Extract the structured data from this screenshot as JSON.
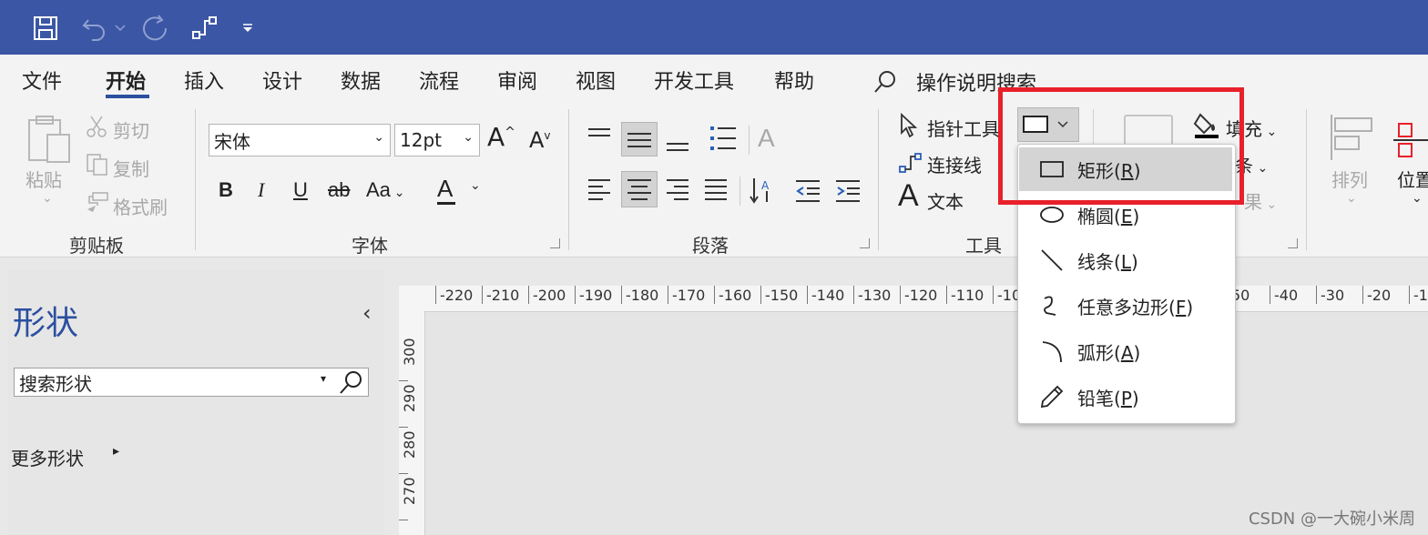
{
  "menu": {
    "items": [
      "文件",
      "开始",
      "插入",
      "设计",
      "数据",
      "流程",
      "审阅",
      "视图",
      "开发工具",
      "帮助"
    ],
    "active": "开始",
    "search_label": "操作说明搜索"
  },
  "clipboard": {
    "paste": "粘贴",
    "cut": "剪切",
    "copy": "复制",
    "format_painter": "格式刷",
    "group_label": "剪贴板"
  },
  "font": {
    "name": "宋体",
    "size": "12pt",
    "bold": "B",
    "italic": "I",
    "underline": "U",
    "strike": "ab",
    "case": "Aa",
    "color": "A",
    "grow": "A",
    "shrink": "A",
    "group_label": "字体"
  },
  "paragraph": {
    "group_label": "段落"
  },
  "tools": {
    "pointer": "指针工具",
    "connector": "连接线",
    "text": "文本",
    "text_icon": "A",
    "group_label": "工具"
  },
  "shape_style": {
    "fill": "填充",
    "line": "条",
    "effects": "果"
  },
  "arrange": {
    "arrange_label": "排列",
    "position_label": "位置"
  },
  "shapes_panel": {
    "title": "形状",
    "search_placeholder": "搜索形状",
    "more_shapes": "更多形状"
  },
  "ruler": {
    "horizontal": [
      "-220",
      "-210",
      "-200",
      "-190",
      "-180",
      "-170",
      "-160",
      "-150",
      "-140",
      "-130",
      "-120",
      "-110",
      "-10",
      "50",
      "-40",
      "-30",
      "-20",
      "-1"
    ],
    "vertical": [
      "300",
      "290",
      "280",
      "270"
    ]
  },
  "dropdown": {
    "items": [
      {
        "label": "矩形",
        "key": "R",
        "icon": "rectangle-icon"
      },
      {
        "label": "椭圆",
        "key": "E",
        "icon": "ellipse-icon"
      },
      {
        "label": "线条",
        "key": "L",
        "icon": "line-icon"
      },
      {
        "label": "任意多边形",
        "key": "F",
        "icon": "freeform-icon"
      },
      {
        "label": "弧形",
        "key": "A",
        "icon": "arc-icon"
      },
      {
        "label": "铅笔",
        "key": "P",
        "icon": "pencil-icon"
      }
    ]
  },
  "watermark": "CSDN @一大碗小米周",
  "colors": {
    "titlebar": "#3b56a5",
    "accent": "#2b4fa0",
    "highlight": "#e8202a"
  }
}
